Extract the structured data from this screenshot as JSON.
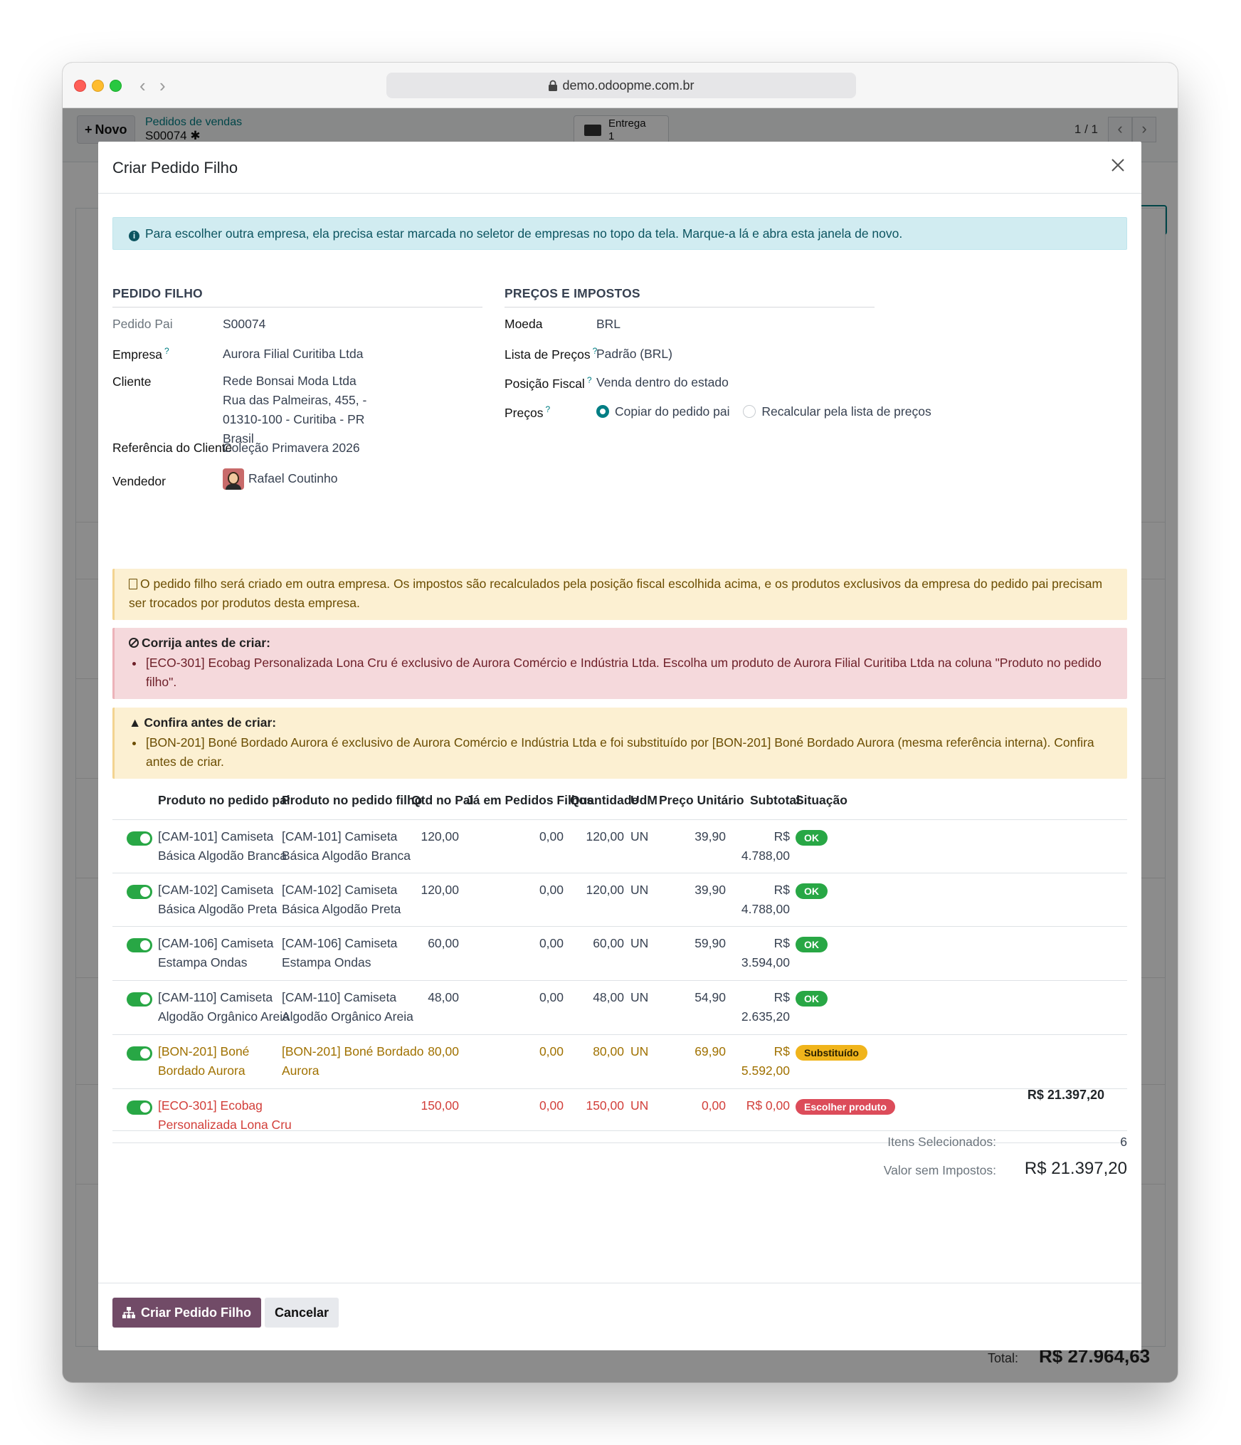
{
  "browser": {
    "url": "demo.odoopme.com.br"
  },
  "background": {
    "new_button": "Novo",
    "breadcrumb_parent": "Pedidos de vendas",
    "breadcrumb_current": "S00074",
    "smart_button_label": "Entrega",
    "smart_button_count": "1",
    "pager": "1 / 1",
    "total_label": "Total:",
    "total_value": "R$ 27.964,63"
  },
  "modal": {
    "title": "Criar Pedido Filho",
    "info_alert": "Para escolher outra empresa, ela precisa estar marcada no seletor de empresas no topo da tela. Marque-a lá e abra esta janela de novo.",
    "left_section": "PEDIDO FILHO",
    "right_section": "PREÇOS E IMPOSTOS",
    "fields": {
      "pedido_pai": {
        "label": "Pedido Pai",
        "value": "S00074"
      },
      "empresa": {
        "label": "Empresa",
        "value": "Aurora Filial Curitiba Ltda"
      },
      "cliente": {
        "label": "Cliente",
        "name": "Rede Bonsai Moda Ltda",
        "address1": "Rua das Palmeiras, 455, -",
        "address2": "01310-100 - Curitiba - PR",
        "address3": "Brasil"
      },
      "referencia": {
        "label": "Referência do Cliente",
        "value": "Coleção Primavera 2026"
      },
      "vendedor": {
        "label": "Vendedor",
        "value": "Rafael Coutinho"
      },
      "moeda": {
        "label": "Moeda",
        "value": "BRL"
      },
      "lista_precos": {
        "label": "Lista de Preços",
        "value": "Padrão (BRL)"
      },
      "posicao_fiscal": {
        "label": "Posição Fiscal",
        "value": "Venda dentro do estado"
      },
      "precos": {
        "label": "Preços",
        "option_selected": "Copiar do pedido pai",
        "option_other": "Recalcular pela lista de preços"
      }
    },
    "help_mark": "?",
    "warn_alert": "O pedido filho será criado em outra empresa. Os impostos são recalculados pela posição fiscal escolhida acima, e os produtos exclusivos da empresa do pedido pai precisam ser trocados por produtos desta empresa.",
    "danger_alert": {
      "title": "Corrija antes de criar:",
      "item": "[ECO-301] Ecobag Personalizada Lona Cru é exclusivo de Aurora Comércio e Indústria Ltda. Escolha um produto de Aurora Filial Curitiba Ltda na coluna \"Produto no pedido filho\"."
    },
    "check_alert": {
      "title": "Confira antes de criar:",
      "item": "[BON-201] Boné Bordado Aurora é exclusivo de Aurora Comércio e Indústria Ltda e foi substituído por [BON-201] Boné Bordado Aurora (mesma referência interna). Confira antes de criar."
    },
    "table": {
      "headers": {
        "produto_pai": "Produto no pedido pai",
        "produto_filho": "Produto no pedido filho",
        "qtd_pai": "Qtd no Pai",
        "ja_filhos": "Já em Pedidos Filhos",
        "quantidade": "Quantidade",
        "udm": "UdM",
        "preco": "Preço Unitário",
        "subtotal": "Subtotal",
        "situacao": "Situação"
      },
      "rows": [
        {
          "produto_pai_1": "[CAM-101] Camiseta",
          "produto_pai_2": "Básica Algodão Branca",
          "produto_filho_1": "[CAM-101] Camiseta",
          "produto_filho_2": "Básica Algodão Branca",
          "qtd_pai": "120,00",
          "ja_filhos": "0,00",
          "quantidade": "120,00",
          "udm": "UN",
          "preco": "39,90",
          "subtotal": "R$ 4.788,00",
          "situacao": "OK",
          "status": "ok"
        },
        {
          "produto_pai_1": "[CAM-102] Camiseta",
          "produto_pai_2": "Básica Algodão Preta",
          "produto_filho_1": "[CAM-102] Camiseta",
          "produto_filho_2": "Básica Algodão Preta",
          "qtd_pai": "120,00",
          "ja_filhos": "0,00",
          "quantidade": "120,00",
          "udm": "UN",
          "preco": "39,90",
          "subtotal": "R$ 4.788,00",
          "situacao": "OK",
          "status": "ok"
        },
        {
          "produto_pai_1": "[CAM-106] Camiseta",
          "produto_pai_2": "Estampa Ondas",
          "produto_filho_1": "[CAM-106] Camiseta",
          "produto_filho_2": "Estampa Ondas",
          "qtd_pai": "60,00",
          "ja_filhos": "0,00",
          "quantidade": "60,00",
          "udm": "UN",
          "preco": "59,90",
          "subtotal": "R$ 3.594,00",
          "situacao": "OK",
          "status": "ok"
        },
        {
          "produto_pai_1": "[CAM-110] Camiseta",
          "produto_pai_2": "Algodão Orgânico Areia",
          "produto_filho_1": "[CAM-110] Camiseta",
          "produto_filho_2": "Algodão Orgânico Areia",
          "qtd_pai": "48,00",
          "ja_filhos": "0,00",
          "quantidade": "48,00",
          "udm": "UN",
          "preco": "54,90",
          "subtotal": "R$ 2.635,20",
          "situacao": "OK",
          "status": "ok"
        },
        {
          "produto_pai_1": "[BON-201] Boné",
          "produto_pai_2": "Bordado Aurora",
          "produto_filho_1": "[BON-201] Boné Bordado",
          "produto_filho_2": "Aurora",
          "qtd_pai": "80,00",
          "ja_filhos": "0,00",
          "quantidade": "80,00",
          "udm": "UN",
          "preco": "69,90",
          "subtotal": "R$ 5.592,00",
          "situacao": "Substituído",
          "status": "sub"
        },
        {
          "produto_pai_1": "[ECO-301] Ecobag",
          "produto_pai_2": "Personalizada Lona Cru",
          "produto_filho_1": "",
          "produto_filho_2": "",
          "qtd_pai": "150,00",
          "ja_filhos": "0,00",
          "quantidade": "150,00",
          "udm": "UN",
          "preco": "0,00",
          "subtotal": "R$ 0,00",
          "situacao": "Escolher produto",
          "status": "esc"
        }
      ],
      "footer_total": "R$ 21.397,20"
    },
    "summary": {
      "itens_label": "Itens Selecionados:",
      "itens_value": "6",
      "valor_label": "Valor sem Impostos:",
      "valor_value": "R$ 21.397,20"
    },
    "buttons": {
      "create": "Criar Pedido Filho",
      "cancel": "Cancelar"
    }
  },
  "colors": {
    "primary": "#714b67",
    "accent": "#017e84",
    "ok": "#28a745",
    "warning": "#f0b41b",
    "danger": "#dc4c5a"
  }
}
